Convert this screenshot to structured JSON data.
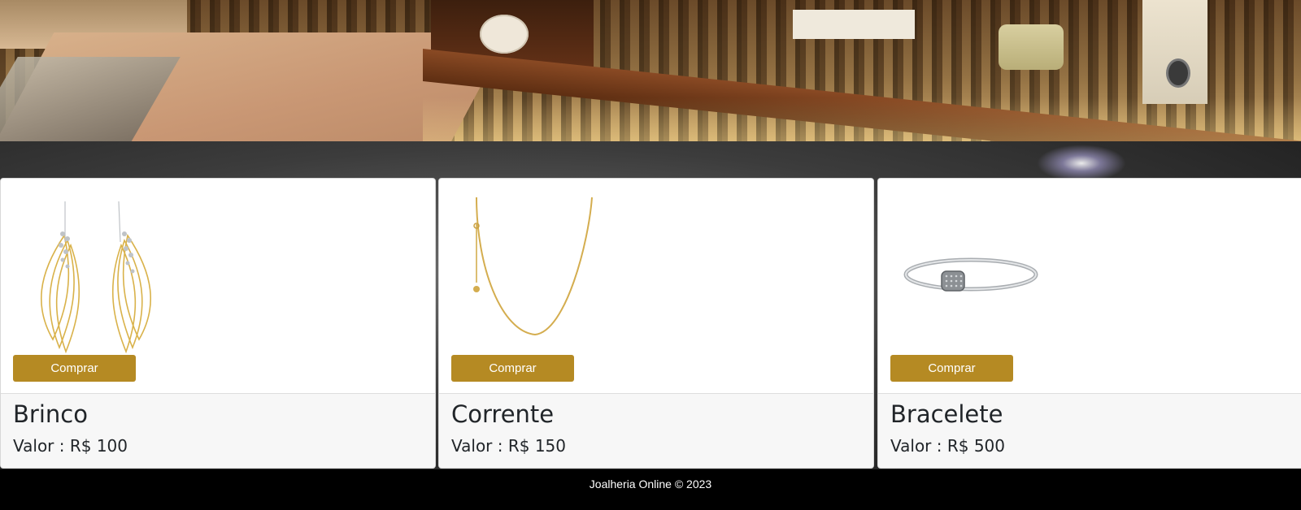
{
  "hero": {
    "image": "jewelry-store-interior"
  },
  "products": [
    {
      "name": "Brinco",
      "price": "Valor : R$ 100",
      "button": "Comprar",
      "image": "gold-drop-earrings"
    },
    {
      "name": "Corrente",
      "price": "Valor : R$ 150",
      "button": "Comprar",
      "image": "gold-chain-necklace"
    },
    {
      "name": "Bracelete",
      "price": "Valor : R$ 500",
      "button": "Comprar",
      "image": "silver-bracelet"
    }
  ],
  "footer": {
    "text": "Joalheria Online © 2023"
  },
  "colors": {
    "button": "#b58a23",
    "footer_bg": "#000000",
    "card_footer_bg": "#f7f7f7"
  }
}
